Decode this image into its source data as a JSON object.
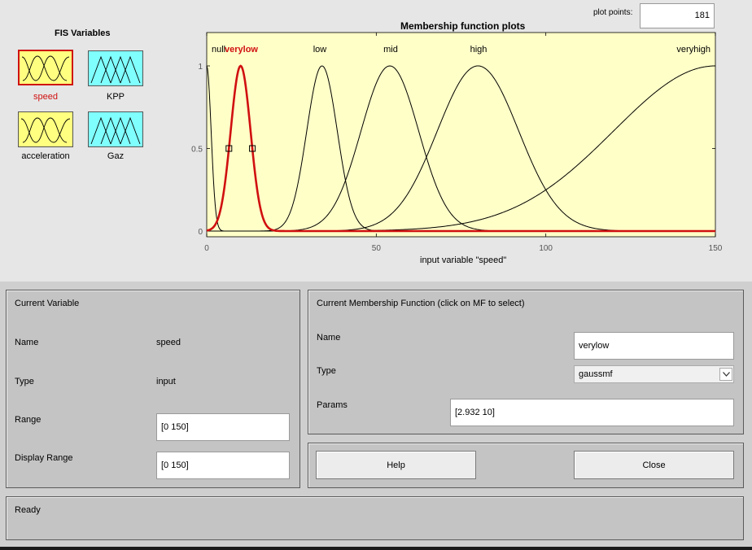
{
  "fis_variables": {
    "title": "FIS Variables",
    "items": [
      {
        "label": "speed",
        "kind": "input",
        "selected": true
      },
      {
        "label": "KPP",
        "kind": "output",
        "selected": false
      },
      {
        "label": "acceleration",
        "kind": "input",
        "selected": false
      },
      {
        "label": "Gaz",
        "kind": "output",
        "selected": false
      }
    ]
  },
  "plot_points": {
    "label": "plot points:",
    "value": "181"
  },
  "plot": {
    "title": "Membership function plots",
    "xlabel": "input variable \"speed\"",
    "xlim": [
      0,
      150
    ],
    "ylim": [
      0,
      1
    ],
    "x_ticks": [
      "0",
      "50",
      "100",
      "150"
    ],
    "y_ticks": [
      "0",
      "0.5",
      "1"
    ],
    "background": "#ffffc8",
    "highlight_color": "#d01010",
    "mf_labels": [
      "null",
      "verylow",
      "low",
      "mid",
      "high",
      "veryhigh"
    ],
    "selected_mf": "verylow"
  },
  "chart_data": {
    "type": "line",
    "title": "Membership function plots",
    "xlabel": "input variable \"speed\"",
    "ylabel": "",
    "xlim": [
      0,
      150
    ],
    "ylim": [
      0,
      1
    ],
    "series": [
      {
        "name": "null",
        "mf": "gaussmf",
        "params": [
          1.3,
          0
        ]
      },
      {
        "name": "verylow",
        "mf": "gaussmf",
        "params": [
          2.932,
          10
        ]
      },
      {
        "name": "low",
        "mf": "gaussmf",
        "params": [
          4.5,
          34
        ]
      },
      {
        "name": "mid",
        "mf": "gaussmf",
        "params": [
          8.5,
          54
        ]
      },
      {
        "name": "high",
        "mf": "gaussmf",
        "params": [
          12,
          80
        ]
      },
      {
        "name": "veryhigh",
        "mf": "gaussmf",
        "params": [
          30,
          150
        ]
      }
    ]
  },
  "current_variable": {
    "title": "Current Variable",
    "name_label": "Name",
    "name_value": "speed",
    "type_label": "Type",
    "type_value": "input",
    "range_label": "Range",
    "range_value": "[0 150]",
    "display_range_label": "Display Range",
    "display_range_value": "[0 150]"
  },
  "current_mf": {
    "title": "Current Membership Function (click on MF to select)",
    "name_label": "Name",
    "name_value": "verylow",
    "type_label": "Type",
    "type_value": "gaussmf",
    "params_label": "Params",
    "params_value": "[2.932 10]"
  },
  "buttons": {
    "help": "Help",
    "close": "Close"
  },
  "status": {
    "text": "Ready"
  }
}
